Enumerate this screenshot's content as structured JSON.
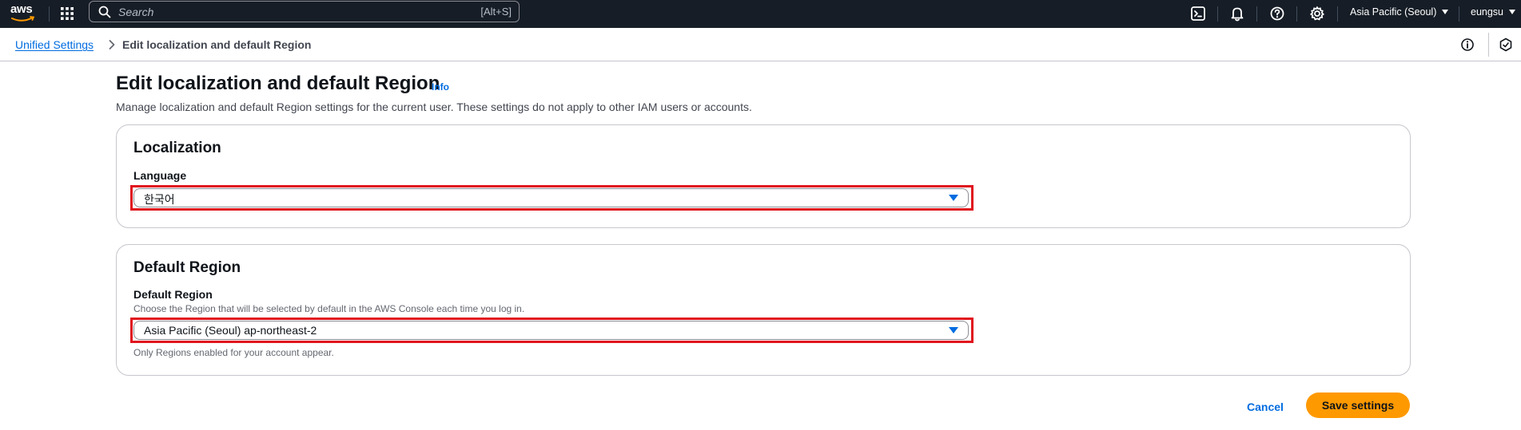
{
  "topnav": {
    "logo_text": "aws",
    "search": {
      "placeholder": "Search",
      "shortcut": "[Alt+S]"
    },
    "icons": [
      "cloudshell-icon",
      "bell-icon",
      "help-icon",
      "gear-icon"
    ],
    "region_label": "Asia Pacific (Seoul)",
    "user_label": "eungsu"
  },
  "breadcrumb": {
    "parent": "Unified Settings",
    "current": "Edit localization and default Region"
  },
  "header": {
    "title": "Edit localization and default Region",
    "info": "Info",
    "description": "Manage localization and default Region settings for the current user. These settings do not apply to other IAM users or accounts."
  },
  "localization": {
    "title": "Localization",
    "language_label": "Language",
    "language_value": "한국어"
  },
  "default_region": {
    "title": "Default Region",
    "field_label": "Default Region",
    "field_description": "Choose the Region that will be selected by default in the AWS Console each time you log in.",
    "value": "Asia Pacific (Seoul) ap-northeast-2",
    "constraint": "Only Regions enabled for your account appear."
  },
  "actions": {
    "cancel": "Cancel",
    "save": "Save settings"
  },
  "colors": {
    "nav_bg": "#161d26",
    "link": "#006ce0",
    "primary_button": "#ff9900",
    "highlight_border": "#e0141e"
  }
}
